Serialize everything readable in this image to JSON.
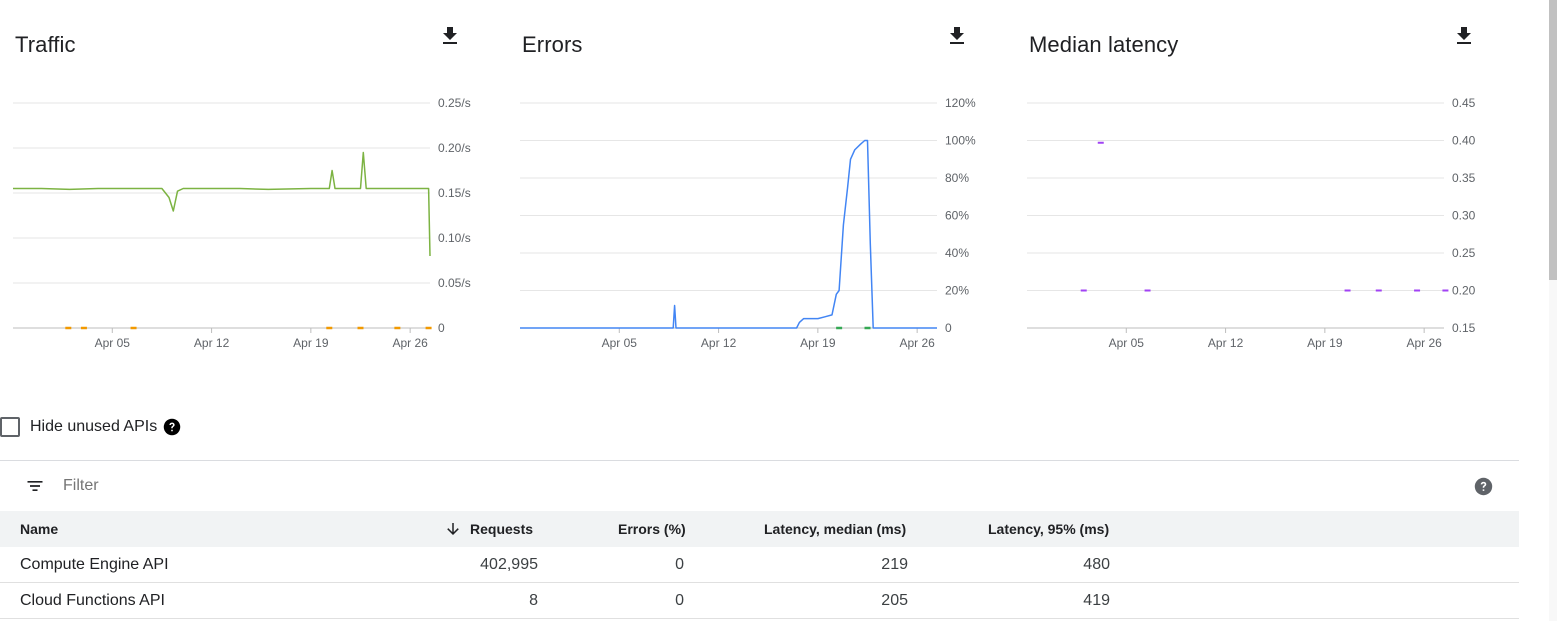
{
  "charts": {
    "traffic": {
      "title": "Traffic",
      "download_icon": "download-icon",
      "y_ticks": [
        "0.25/s",
        "0.20/s",
        "0.15/s",
        "0.10/s",
        "0.05/s",
        "0"
      ],
      "x_ticks": [
        "Apr 05",
        "Apr 12",
        "Apr 19",
        "Apr 26"
      ]
    },
    "errors": {
      "title": "Errors",
      "download_icon": "download-icon",
      "y_ticks": [
        "120%",
        "100%",
        "80%",
        "60%",
        "40%",
        "20%",
        "0"
      ],
      "x_ticks": [
        "Apr 05",
        "Apr 12",
        "Apr 19",
        "Apr 26"
      ]
    },
    "latency": {
      "title": "Median latency",
      "download_icon": "download-icon",
      "y_ticks": [
        "0.45",
        "0.40",
        "0.35",
        "0.30",
        "0.25",
        "0.20",
        "0.15"
      ],
      "x_ticks": [
        "Apr 05",
        "Apr 12",
        "Apr 19",
        "Apr 26"
      ]
    }
  },
  "chart_data": [
    {
      "type": "line",
      "title": "Traffic",
      "ylim": [
        0,
        0.25
      ],
      "x_range": [
        "Mar 29",
        "Apr 27"
      ],
      "grid": true,
      "series": [
        {
          "color": "#7cb342",
          "values": [
            [
              0.0,
              0.155
            ],
            [
              2.0,
              0.155
            ],
            [
              4.0,
              0.154
            ],
            [
              6.0,
              0.155
            ],
            [
              8.0,
              0.155
            ],
            [
              10.5,
              0.155
            ],
            [
              11.0,
              0.145
            ],
            [
              11.3,
              0.13
            ],
            [
              11.6,
              0.152
            ],
            [
              12.0,
              0.155
            ],
            [
              16.0,
              0.155
            ],
            [
              18.0,
              0.154
            ],
            [
              21.0,
              0.155
            ],
            [
              22.3,
              0.155
            ],
            [
              22.5,
              0.175
            ],
            [
              22.7,
              0.155
            ],
            [
              24.5,
              0.155
            ],
            [
              24.7,
              0.195
            ],
            [
              24.9,
              0.155
            ],
            [
              27.0,
              0.155
            ],
            [
              29.3,
              0.155
            ],
            [
              29.4,
              0.08
            ]
          ]
        },
        {
          "color": "#f29900",
          "points": [
            [
              3.9,
              0
            ],
            [
              5.0,
              0
            ],
            [
              8.5,
              0
            ],
            [
              22.3,
              0
            ],
            [
              24.5,
              0
            ],
            [
              27.1,
              0
            ],
            [
              29.3,
              0
            ]
          ]
        }
      ]
    },
    {
      "type": "line",
      "title": "Errors",
      "ylim": [
        0,
        120
      ],
      "x_range": [
        "Mar 29",
        "Apr 27"
      ],
      "grid": true,
      "series": [
        {
          "color": "#4285f4",
          "values": [
            [
              0,
              0
            ],
            [
              6,
              0
            ],
            [
              10.8,
              0
            ],
            [
              10.9,
              12
            ],
            [
              11.0,
              0
            ],
            [
              19.5,
              0
            ],
            [
              19.7,
              3
            ],
            [
              20.0,
              5
            ],
            [
              21.0,
              5
            ],
            [
              21.5,
              6
            ],
            [
              22.0,
              7
            ],
            [
              22.3,
              18
            ],
            [
              22.5,
              20
            ],
            [
              22.8,
              55
            ],
            [
              23.1,
              75
            ],
            [
              23.3,
              90
            ],
            [
              23.6,
              95
            ],
            [
              24.0,
              98
            ],
            [
              24.3,
              100
            ],
            [
              24.5,
              100
            ],
            [
              24.7,
              45
            ],
            [
              24.9,
              0
            ],
            [
              29.4,
              0
            ]
          ]
        },
        {
          "color": "#34a853",
          "points": [
            [
              22.5,
              0
            ],
            [
              24.5,
              0
            ]
          ]
        }
      ]
    },
    {
      "type": "scatter",
      "title": "Median latency",
      "ylim": [
        0.15,
        0.45
      ],
      "x_range": [
        "Mar 29",
        "Apr 27"
      ],
      "grid": true,
      "series": [
        {
          "color": "#a142f4",
          "points": [
            [
              4.0,
              0.2
            ],
            [
              5.2,
              0.397
            ],
            [
              8.5,
              0.2
            ],
            [
              22.6,
              0.2
            ],
            [
              24.8,
              0.2
            ],
            [
              27.5,
              0.2
            ],
            [
              29.5,
              0.2
            ]
          ]
        }
      ]
    }
  ],
  "hide_unused": {
    "label": "Hide unused APIs",
    "checked": false,
    "help_icon": "help-icon"
  },
  "filter": {
    "icon": "filter-icon",
    "placeholder": "Filter",
    "help_icon": "help-icon"
  },
  "table": {
    "columns": [
      "Name",
      "Requests",
      "Errors (%)",
      "Latency, median (ms)",
      "Latency, 95% (ms)"
    ],
    "sort_icon": "arrow-down-icon",
    "rows": [
      {
        "name": "Compute Engine API",
        "requests": "402,995",
        "errors": "0",
        "lat_median": "219",
        "lat_95": "480"
      },
      {
        "name": "Cloud Functions API",
        "requests": "8",
        "errors": "0",
        "lat_median": "205",
        "lat_95": "419"
      }
    ]
  }
}
